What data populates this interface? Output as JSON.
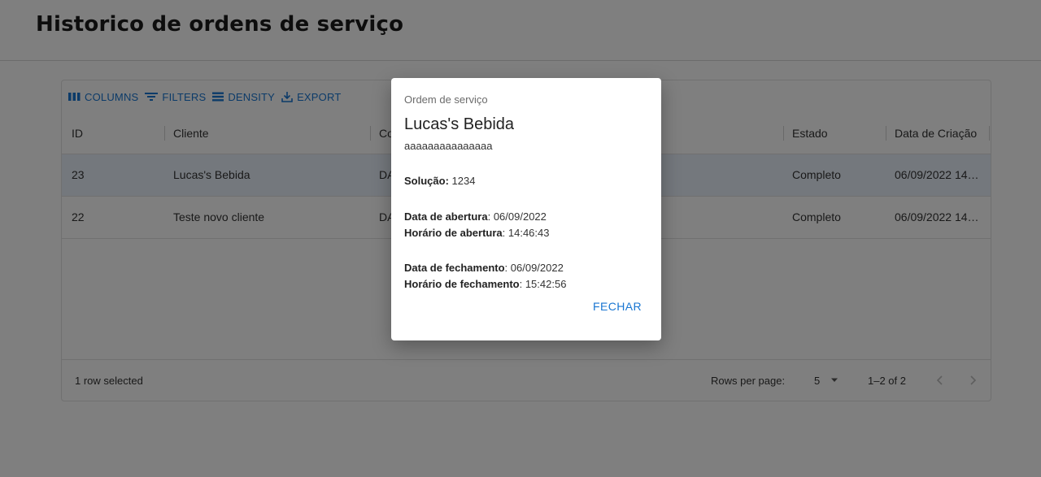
{
  "page": {
    "title": "Historico de ordens de serviço"
  },
  "toolbar": {
    "columns": "Columns",
    "filters": "Filters",
    "density": "Density",
    "export": "Export"
  },
  "grid": {
    "columns": [
      {
        "key": "id",
        "label": "ID"
      },
      {
        "key": "cliente",
        "label": "Cliente"
      },
      {
        "key": "c3",
        "label": "Co"
      },
      {
        "key": "estado",
        "label": "Estado"
      },
      {
        "key": "criacao",
        "label": "Data de Criação"
      }
    ],
    "rows": [
      {
        "id": "23",
        "cliente": "Lucas's Bebida",
        "c3": "DA",
        "estado": "Completo",
        "criacao": "06/09/2022 14…",
        "selected": true
      },
      {
        "id": "22",
        "cliente": "Teste novo cliente",
        "c3": "DA",
        "estado": "Completo",
        "criacao": "06/09/2022 14…",
        "selected": false
      }
    ]
  },
  "footer": {
    "selected_text": "1 row selected",
    "rows_per_page_label": "Rows per page:",
    "rows_per_page_value": "5",
    "range": "1–2 of 2"
  },
  "dialog": {
    "eyebrow": "Ordem de serviço",
    "title": "Lucas's Bebida",
    "description": "aaaaaaaaaaaaaaa",
    "solucao_label": "Solução:",
    "solucao_value": " 1234",
    "abertura_data_label": "Data de abertura",
    "abertura_data_value": ": 06/09/2022",
    "abertura_hora_label": "Horário de abertura",
    "abertura_hora_value": ": 14:46:43",
    "fechamento_data_label": "Data de fechamento",
    "fechamento_data_value": ": 06/09/2022",
    "fechamento_hora_label": "Horário de fechamento",
    "fechamento_hora_value": ": 15:42:56",
    "close_label": "FECHAR"
  },
  "colors": {
    "primary": "#1976d2",
    "selected_row": "#e8f0fb",
    "overlay": "rgba(0,0,0,0.5)"
  }
}
